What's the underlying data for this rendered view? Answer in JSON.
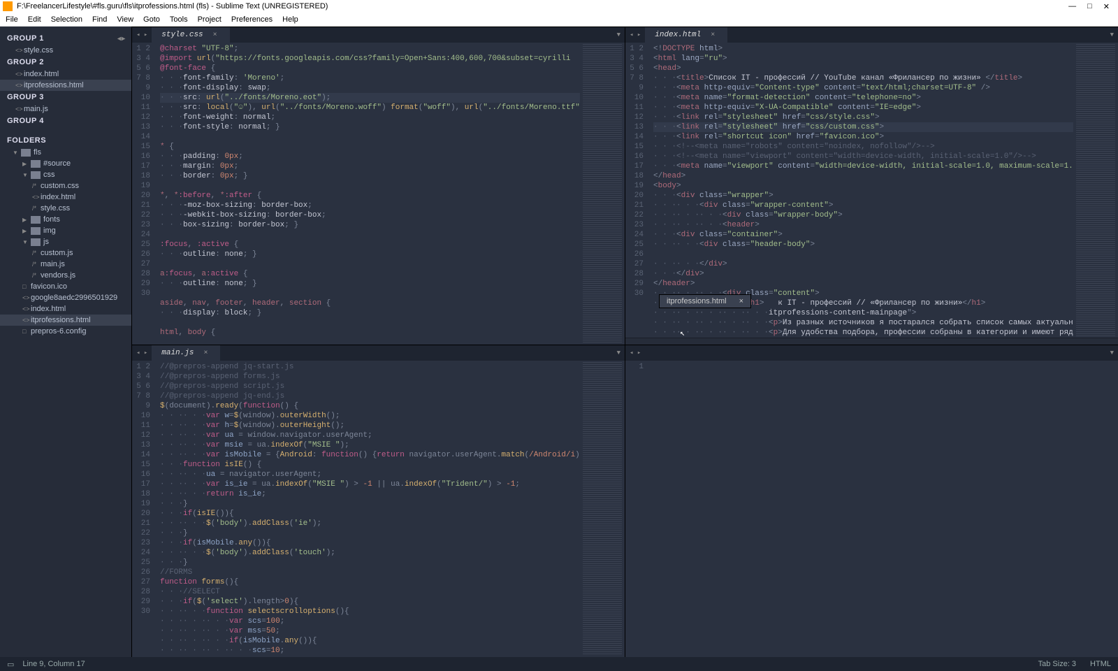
{
  "title": "F:\\FreelancerLifestyle\\#fls.guru\\fls\\itprofessions.html (fls) - Sublime Text (UNREGISTERED)",
  "menubar": [
    "File",
    "Edit",
    "Selection",
    "Find",
    "View",
    "Goto",
    "Tools",
    "Project",
    "Preferences",
    "Help"
  ],
  "sidebar": {
    "groups": [
      {
        "label": "GROUP 1",
        "items": [
          {
            "name": "style.css",
            "icon": "<>"
          }
        ]
      },
      {
        "label": "GROUP 2",
        "items": [
          {
            "name": "index.html",
            "icon": "<>"
          },
          {
            "name": "itprofessions.html",
            "icon": "<>",
            "selected": true
          }
        ]
      },
      {
        "label": "GROUP 3",
        "items": [
          {
            "name": "main.js",
            "icon": "<>"
          }
        ]
      },
      {
        "label": "GROUP 4",
        "items": []
      }
    ],
    "folders_label": "FOLDERS",
    "tree": [
      {
        "d": 0,
        "type": "folder",
        "name": "fls",
        "open": true
      },
      {
        "d": 1,
        "type": "folder",
        "name": "#source",
        "open": false
      },
      {
        "d": 1,
        "type": "folder",
        "name": "css",
        "open": true
      },
      {
        "d": 2,
        "type": "file",
        "name": "custom.css",
        "icon": "/*"
      },
      {
        "d": 2,
        "type": "file",
        "name": "index.html",
        "icon": "<>"
      },
      {
        "d": 2,
        "type": "file",
        "name": "style.css",
        "icon": "/*"
      },
      {
        "d": 1,
        "type": "folder",
        "name": "fonts",
        "open": false
      },
      {
        "d": 1,
        "type": "folder",
        "name": "img",
        "open": false
      },
      {
        "d": 1,
        "type": "folder",
        "name": "js",
        "open": true
      },
      {
        "d": 2,
        "type": "file",
        "name": "custom.js",
        "icon": "/*"
      },
      {
        "d": 2,
        "type": "file",
        "name": "main.js",
        "icon": "/*"
      },
      {
        "d": 2,
        "type": "file",
        "name": "vendors.js",
        "icon": "/*"
      },
      {
        "d": 1,
        "type": "file",
        "name": "favicon.ico",
        "icon": "□"
      },
      {
        "d": 1,
        "type": "file",
        "name": "google8aedc2996501929",
        "icon": "<>"
      },
      {
        "d": 1,
        "type": "file",
        "name": "index.html",
        "icon": "<>"
      },
      {
        "d": 1,
        "type": "file",
        "name": "itprofessions.html",
        "icon": "<>",
        "selected": true
      },
      {
        "d": 1,
        "type": "file",
        "name": "prepros-6.config",
        "icon": "□"
      }
    ]
  },
  "panes": {
    "tl": {
      "tab": "style.css",
      "lines_from": 1,
      "lines_to": 30
    },
    "tr": {
      "tab": "index.html",
      "lines_from": 1,
      "lines_to": 30
    },
    "bl": {
      "tab": "main.js",
      "lines_from": 1,
      "lines_to": 30
    },
    "br": {
      "tab": "",
      "lines_from": 1,
      "lines_to": 1
    }
  },
  "goto_popup": {
    "text": "itprofessions.html",
    "close": "×"
  },
  "statusbar": {
    "left_icon": "▭",
    "pos": "Line 9, Column 17",
    "tabsize": "Tab Size: 3",
    "syntax": "HTML"
  }
}
